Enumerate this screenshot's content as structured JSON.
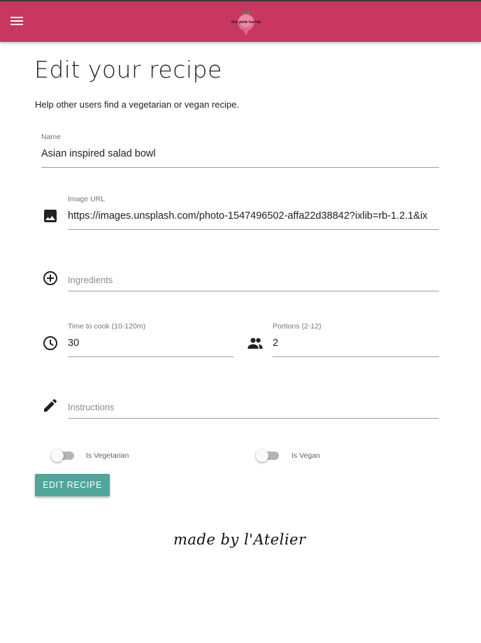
{
  "header": {
    "menu_icon": "hamburger-menu-icon",
    "logo_text": "the pink turnip",
    "logo_icon": "turnip-logo",
    "colors": {
      "bar": "#c8375f",
      "accent": "#4fa69b"
    }
  },
  "page": {
    "title": "Edit your recipe",
    "subtitle": "Help other users find a vegetarian or vegan recipe."
  },
  "form": {
    "name": {
      "label": "Name",
      "value": "Asian inspired salad bowl"
    },
    "image_url": {
      "label": "Image URL",
      "value": "https://images.unsplash.com/photo-1547496502-affa22d38842?ixlib=rb-1.2.1&ix",
      "icon": "image-icon"
    },
    "ingredients": {
      "placeholder": "Ingredients",
      "icon": "add-circle-icon"
    },
    "time": {
      "label": "Time to cook (10-120m)",
      "value": "30",
      "icon": "clock-icon"
    },
    "portions": {
      "label": "Portions (2-12)",
      "value": "2",
      "icon": "people-icon"
    },
    "instructions": {
      "placeholder": "Instructions",
      "icon": "pencil-icon"
    },
    "vegetarian": {
      "label": "Is Vegetarian",
      "checked": false
    },
    "vegan": {
      "label": "Is Vegan",
      "checked": false
    },
    "submit_label": "EDIT RECIPE"
  },
  "footer": {
    "signature": "made by l'Atelier"
  }
}
